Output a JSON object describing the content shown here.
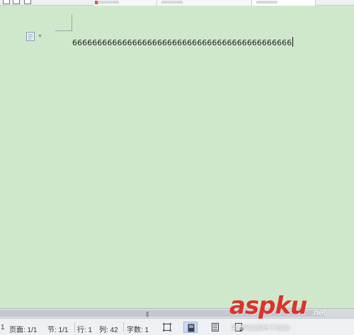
{
  "document": {
    "text": "66666666666666666666666666666666666666666666"
  },
  "status_bar": {
    "line_no": "1",
    "page": "页面: 1/1",
    "section": "节: 1/1",
    "row": "行: 1",
    "column": "列: 42",
    "word_count": "字数: 1"
  },
  "scrollbar": {
    "grip": "|||"
  },
  "watermark": {
    "logo": "aspku",
    "suffix": ".net",
    "tagline": "免费网站源码下载站!"
  },
  "colors": {
    "page_background": "#cfe8cc",
    "watermark_red": "#d9342b",
    "view_active": "#c9daf0"
  }
}
